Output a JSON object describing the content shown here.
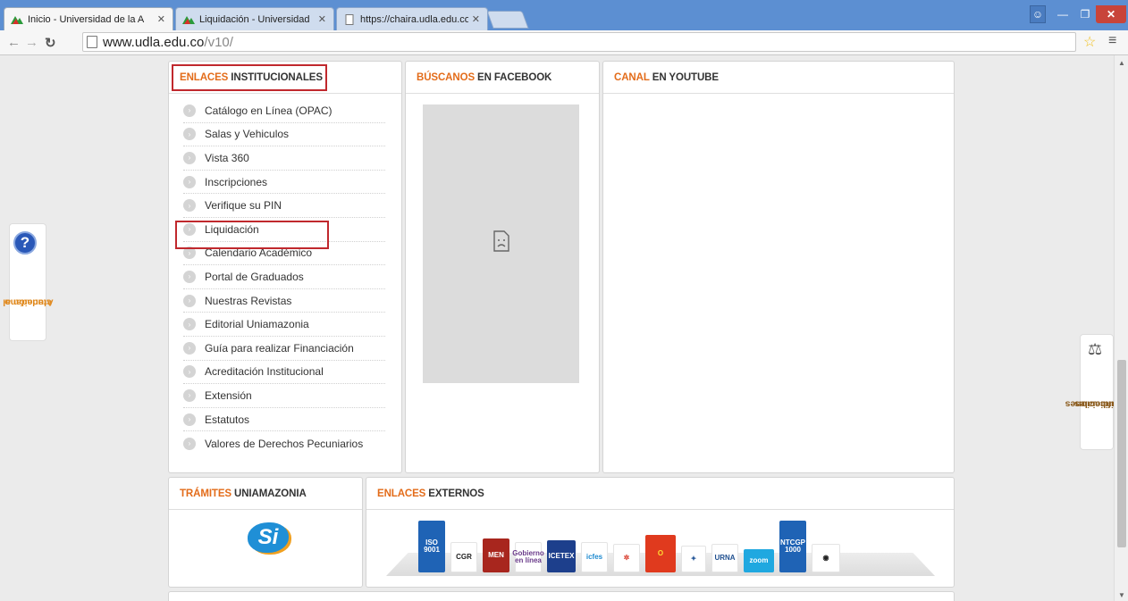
{
  "browser": {
    "tabs": [
      {
        "title": "Inicio - Universidad de la A",
        "close": "✕"
      },
      {
        "title": "Liquidación - Universidad",
        "close": "✕"
      },
      {
        "title": "https://chaira.udla.edu.co/",
        "close": "✕"
      }
    ],
    "url_host": "www.udla.edu.co",
    "url_path": "/v10/"
  },
  "enlaces": {
    "title_highlight": "ENLACES",
    "title_rest": "INSTITUCIONALES",
    "items": [
      "Catálogo en Línea (OPAC)",
      "Salas y Vehiculos",
      "Vista 360",
      "Inscripciones",
      "Verifique su PIN",
      "Liquidación",
      "Calendario Académico",
      "Portal de Graduados",
      "Nuestras Revistas",
      "Editorial Uniamazonia",
      "Guía para realizar Financiación",
      "Acreditación Institucional",
      "Extensión",
      "Estatutos",
      "Valores de Derechos Pecuniarios"
    ]
  },
  "facebook": {
    "title_highlight": "BÚSCANOS",
    "title_rest": "EN FACEBOOK"
  },
  "youtube": {
    "title_highlight": "CANAL",
    "title_rest": "EN YOUTUBE"
  },
  "tramites": {
    "title_highlight": "TRÁMITES",
    "title_rest": "UNIAMAZONIA",
    "logo_text": "Si"
  },
  "externos": {
    "title_highlight": "ENLACES",
    "title_rest": "EXTERNOS",
    "logos": [
      {
        "name": "iso-9001",
        "label": "ISO 9001",
        "bg": "#1f63b5",
        "fg": "#ffffff"
      },
      {
        "name": "cgr",
        "label": "CGR",
        "bg": "#ffffff",
        "fg": "#222222"
      },
      {
        "name": "men",
        "label": "MEN",
        "bg": "#a8261e",
        "fg": "#ffffff"
      },
      {
        "name": "gobierno-en-linea",
        "label": "Gobierno en línea",
        "bg": "#ffffff",
        "fg": "#6a3b8a"
      },
      {
        "name": "icetex",
        "label": "ICETEX",
        "bg": "#1d3f8c",
        "fg": "#ffffff"
      },
      {
        "name": "icfes",
        "label": "icfes",
        "bg": "#ffffff",
        "fg": "#1f8bd0"
      },
      {
        "name": "colciencias",
        "label": "✲",
        "bg": "#ffffff",
        "fg": "#d83a2a"
      },
      {
        "name": "o-logo",
        "label": "O",
        "bg": "#e03a1e",
        "fg": "#ffdd33"
      },
      {
        "name": "compass",
        "label": "✦",
        "bg": "#ffffff",
        "fg": "#2a5a9a"
      },
      {
        "name": "urna-de-cristal",
        "label": "URNA",
        "bg": "#ffffff",
        "fg": "#1f4f8f"
      },
      {
        "name": "zoom",
        "label": "zoom",
        "bg": "#1fa8e0",
        "fg": "#ffffff"
      },
      {
        "name": "ntcgp-1000",
        "label": "NTCGP 1000",
        "bg": "#1f63b5",
        "fg": "#ffffff"
      },
      {
        "name": "radio",
        "label": "◉",
        "bg": "#ffffff",
        "fg": "#222222"
      }
    ]
  },
  "side_tabs": {
    "atencion_line1": "Atención al",
    "atencion_line2": "ciudadano",
    "notif_line1": "Notificaciones",
    "notif_line2": "Judiciales"
  }
}
